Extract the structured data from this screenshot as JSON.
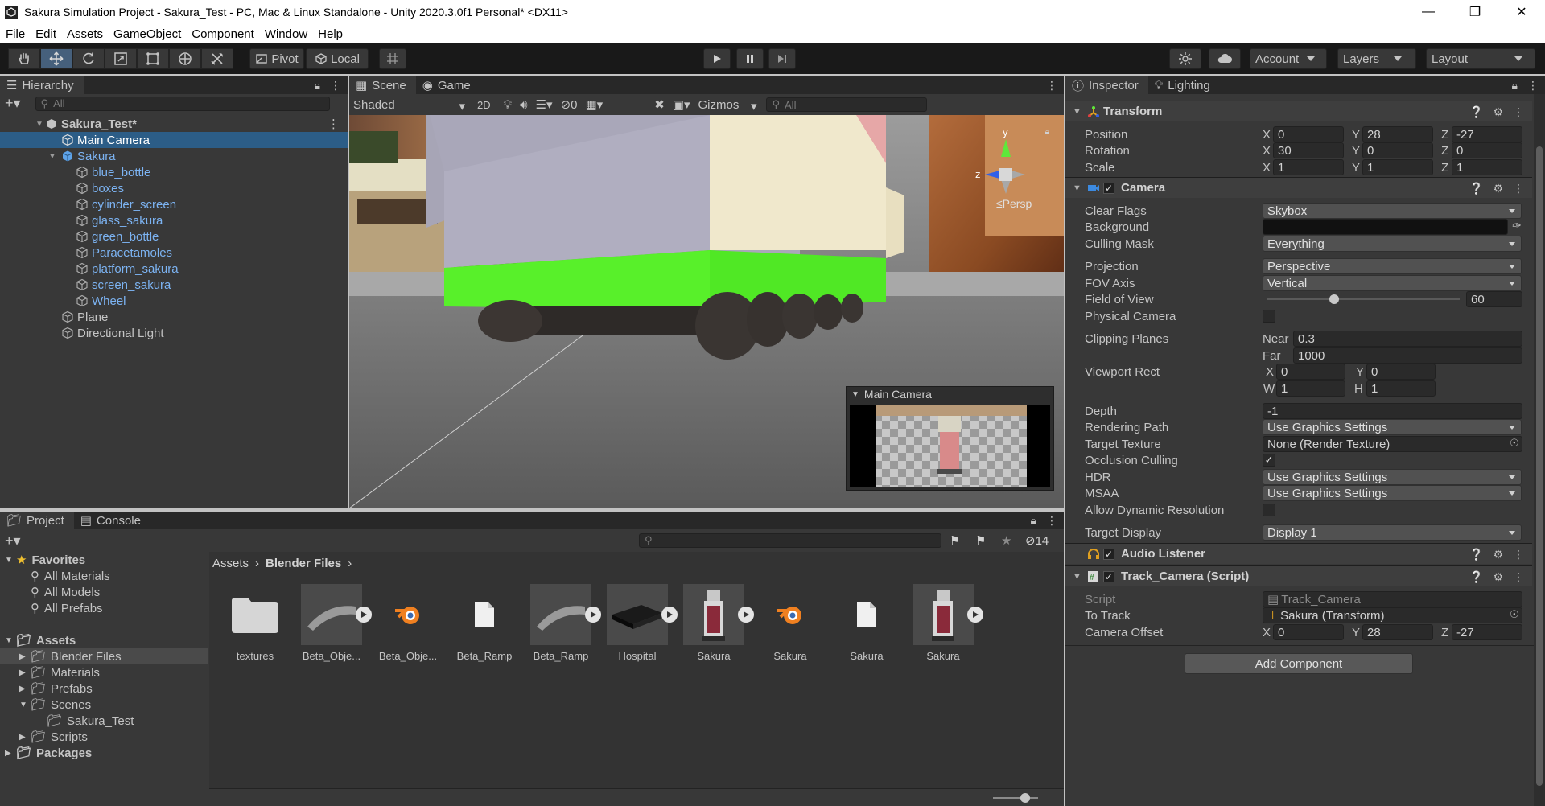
{
  "window": {
    "title": "Sakura Simulation Project - Sakura_Test - PC, Mac & Linux Standalone - Unity 2020.3.0f1 Personal* <DX11>",
    "controls": [
      "minimize",
      "restore",
      "close"
    ]
  },
  "menu": [
    "File",
    "Edit",
    "Assets",
    "GameObject",
    "Component",
    "Window",
    "Help"
  ],
  "toolbar": {
    "tools": [
      "hand-tool",
      "move-tool",
      "rotate-tool",
      "scale-tool",
      "rect-tool",
      "transform-tool",
      "custom-tool"
    ],
    "active_tool": "move-tool",
    "pivot_label": "Pivot",
    "local_label": "Local",
    "account_label": "Account",
    "layers_label": "Layers",
    "layout_label": "Layout"
  },
  "hierarchy": {
    "tab_label": "Hierarchy",
    "search_placeholder": "All",
    "scene_name": "Sakura_Test*",
    "items": [
      {
        "label": "Main Camera",
        "selected": true
      },
      {
        "label": "Sakura",
        "expanded": true,
        "children": [
          "blue_bottle",
          "boxes",
          "cylinder_screen",
          "glass_sakura",
          "green_bottle",
          "Paracetamoles",
          "platform_sakura",
          "screen_sakura",
          "Wheel"
        ]
      },
      {
        "label": "Plane"
      },
      {
        "label": "Directional Light"
      }
    ]
  },
  "scene": {
    "tabs": [
      "Scene",
      "Game"
    ],
    "active_tab": "Scene",
    "shading_mode": "Shaded",
    "mode_2d": "2D",
    "hidden_count": "0",
    "gizmos_label": "Gizmos",
    "search_placeholder": "All",
    "axis_labels": {
      "y": "y",
      "z": "z"
    },
    "projection_label": "≤Persp",
    "camera_preview_title": "Main Camera"
  },
  "project": {
    "tabs": [
      "Project",
      "Console"
    ],
    "active_tab": "Project",
    "hidden_count": "14",
    "breadcrumb": [
      "Assets",
      "Blender Files"
    ],
    "favorites": {
      "label": "Favorites",
      "items": [
        "All Materials",
        "All Models",
        "All Prefabs"
      ]
    },
    "assets": {
      "label": "Assets",
      "items": [
        "Blender Files",
        "Materials",
        "Prefabs",
        "Scenes",
        "Sakura_Test",
        "Scripts"
      ]
    },
    "packages_label": "Packages",
    "files": [
      {
        "label": "textures",
        "kind": "folder"
      },
      {
        "label": "Beta_Obje...",
        "kind": "model"
      },
      {
        "label": "Beta_Obje...",
        "kind": "blender"
      },
      {
        "label": "Beta_Ramp",
        "kind": "file"
      },
      {
        "label": "Beta_Ramp",
        "kind": "model"
      },
      {
        "label": "Hospital",
        "kind": "model"
      },
      {
        "label": "Sakura",
        "kind": "model"
      },
      {
        "label": "Sakura",
        "kind": "blender"
      },
      {
        "label": "Sakura",
        "kind": "file"
      },
      {
        "label": "Sakura",
        "kind": "model"
      }
    ]
  },
  "inspector": {
    "tabs": [
      "Inspector",
      "Lighting"
    ],
    "transform": {
      "title": "Transform",
      "position": {
        "label": "Position",
        "x": "0",
        "y": "28",
        "z": "-27"
      },
      "rotation": {
        "label": "Rotation",
        "x": "30",
        "y": "0",
        "z": "0"
      },
      "scale": {
        "label": "Scale",
        "x": "1",
        "y": "1",
        "z": "1"
      }
    },
    "camera": {
      "title": "Camera",
      "clear_flags": {
        "label": "Clear Flags",
        "value": "Skybox"
      },
      "background": {
        "label": "Background"
      },
      "culling_mask": {
        "label": "Culling Mask",
        "value": "Everything"
      },
      "projection": {
        "label": "Projection",
        "value": "Perspective"
      },
      "fov_axis": {
        "label": "FOV Axis",
        "value": "Vertical"
      },
      "field_of_view": {
        "label": "Field of View",
        "value": "60",
        "slider_fraction": 0.35
      },
      "physical_camera": {
        "label": "Physical Camera",
        "checked": false
      },
      "clipping_planes": {
        "label": "Clipping Planes",
        "near_label": "Near",
        "near": "0.3",
        "far_label": "Far",
        "far": "1000"
      },
      "viewport_rect": {
        "label": "Viewport Rect",
        "x": "0",
        "y": "0",
        "w": "1",
        "h": "1"
      },
      "depth": {
        "label": "Depth",
        "value": "-1"
      },
      "rendering_path": {
        "label": "Rendering Path",
        "value": "Use Graphics Settings"
      },
      "target_texture": {
        "label": "Target Texture",
        "value": "None (Render Texture)"
      },
      "occlusion_culling": {
        "label": "Occlusion Culling",
        "checked": true
      },
      "hdr": {
        "label": "HDR",
        "value": "Use Graphics Settings"
      },
      "msaa": {
        "label": "MSAA",
        "value": "Use Graphics Settings"
      },
      "allow_dynamic_resolution": {
        "label": "Allow Dynamic Resolution",
        "checked": false
      },
      "target_display": {
        "label": "Target Display",
        "value": "Display 1"
      }
    },
    "audio_listener": {
      "title": "Audio Listener"
    },
    "track_camera": {
      "title": "Track_Camera (Script)",
      "script": {
        "label": "Script",
        "value": "Track_Camera"
      },
      "to_track": {
        "label": "To Track",
        "value": "Sakura (Transform)"
      },
      "camera_offset": {
        "label": "Camera Offset",
        "x": "0",
        "y": "28",
        "z": "-27"
      }
    },
    "add_component_label": "Add Component"
  },
  "colors": {
    "selection": "#2c5d87",
    "prefab_text": "#7cb3f2",
    "green_box": "#55f02a"
  }
}
